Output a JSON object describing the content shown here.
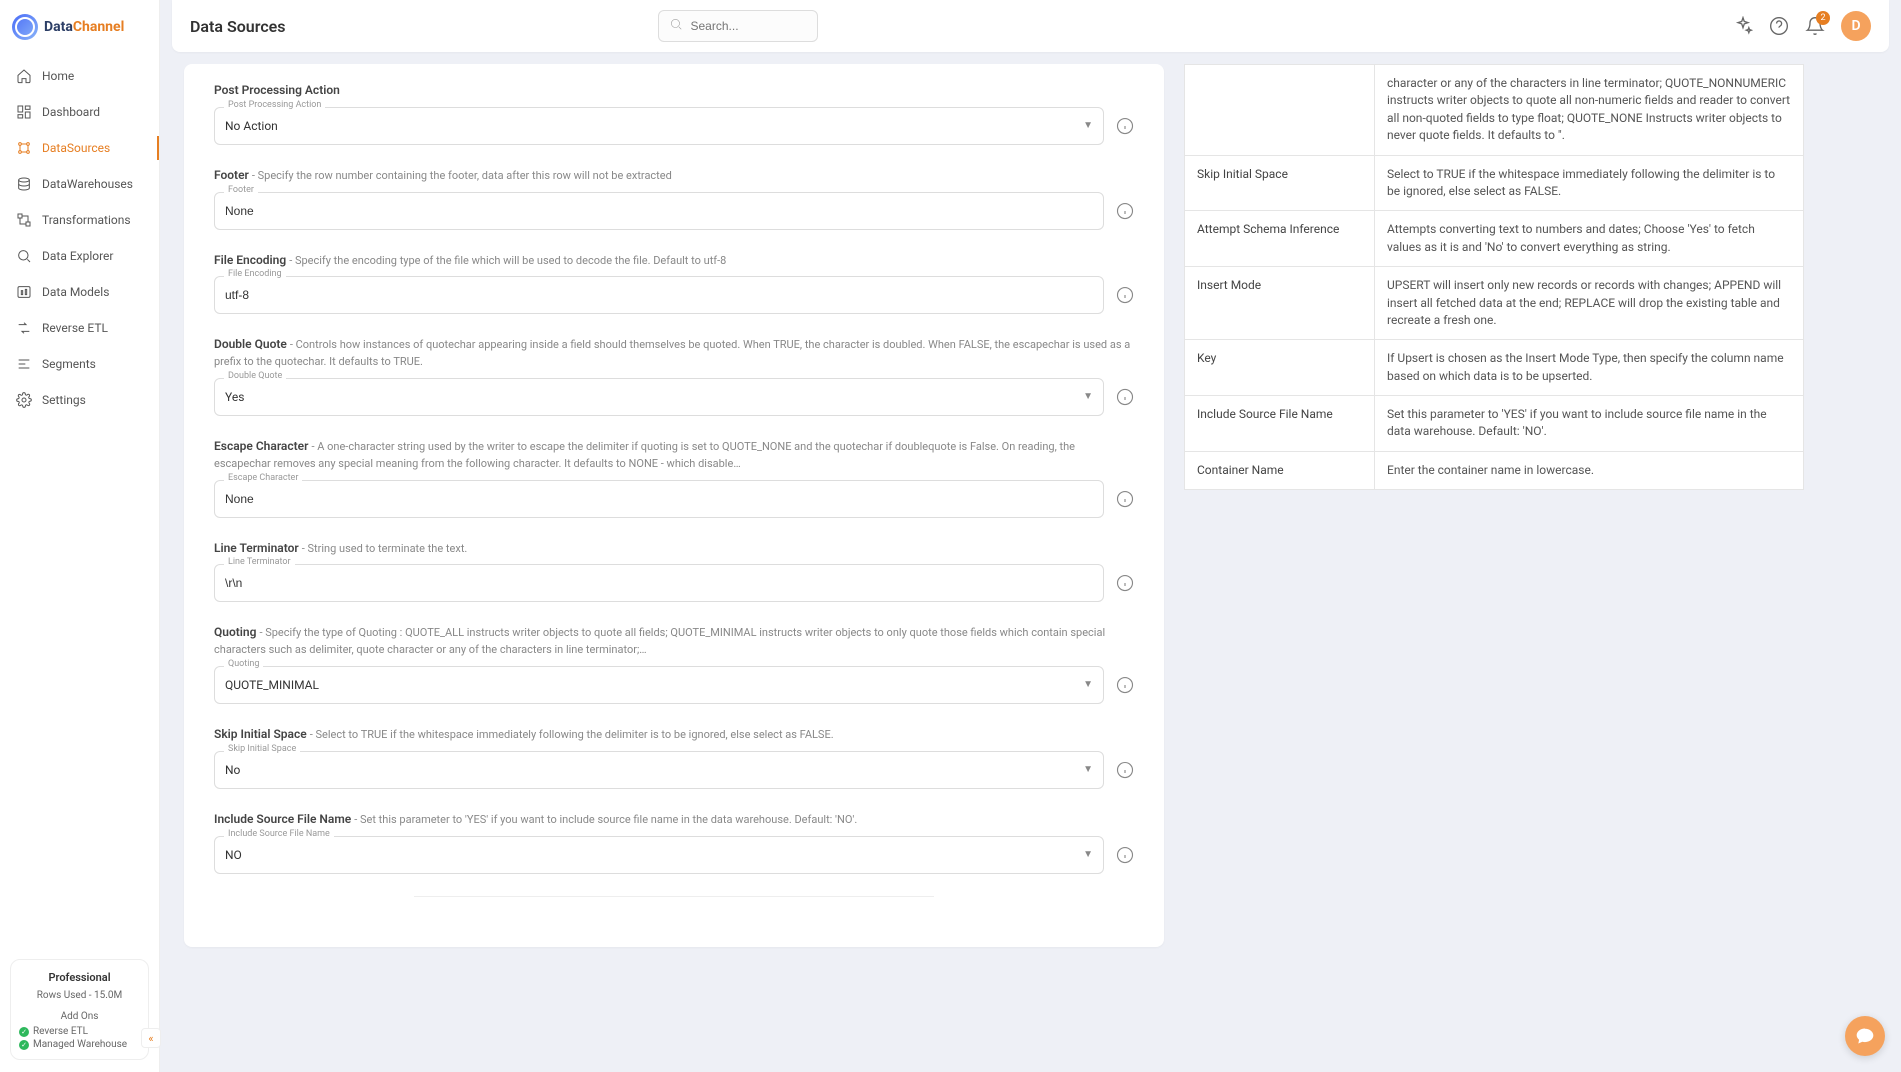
{
  "brand": {
    "part1": "Data",
    "part2": "Channel"
  },
  "nav": [
    {
      "label": "Home"
    },
    {
      "label": "Dashboard"
    },
    {
      "label": "DataSources"
    },
    {
      "label": "DataWarehouses"
    },
    {
      "label": "Transformations"
    },
    {
      "label": "Data Explorer"
    },
    {
      "label": "Data Models"
    },
    {
      "label": "Reverse ETL"
    },
    {
      "label": "Segments"
    },
    {
      "label": "Settings"
    }
  ],
  "plan": {
    "title": "Professional",
    "rows": "Rows Used - 15.0M",
    "addons": "Add Ons",
    "feat1": "Reverse ETL",
    "feat2": "Managed Warehouse"
  },
  "header": {
    "title": "Data Sources",
    "search_placeholder": "Search...",
    "notif_count": "2",
    "avatar": "D"
  },
  "form": {
    "postproc": {
      "name": "Post Processing Action",
      "float": "Post Processing Action",
      "value": "No Action"
    },
    "footer": {
      "name": "Footer",
      "desc": "- Specify the row number containing the footer, data after this row will not be extracted",
      "float": "Footer",
      "value": "None"
    },
    "encoding": {
      "name": "File Encoding",
      "desc": "- Specify the encoding type of the file which will be used to decode the file. Default to utf-8",
      "float": "File Encoding",
      "value": "utf-8"
    },
    "dquote": {
      "name": "Double Quote",
      "desc": "- Controls how instances of quotechar appearing inside a field should themselves be quoted. When TRUE, the character is doubled. When FALSE, the escapechar is used as a prefix to the quotechar. It defaults to TRUE.",
      "float": "Double Quote",
      "value": "Yes"
    },
    "escape": {
      "name": "Escape Character",
      "desc": "- A one-character string used by the writer to escape the delimiter if quoting is set to QUOTE_NONE and the quotechar if doublequote is False. On reading, the escapechar removes any special meaning from the following character. It defaults to NONE - which disable…",
      "float": "Escape Character",
      "value": "None"
    },
    "lterm": {
      "name": "Line Terminator",
      "desc": "- String used to terminate the text.",
      "float": "Line Terminator",
      "value": "\\r\\n"
    },
    "quoting": {
      "name": "Quoting",
      "desc": "- Specify the type of Quoting : QUOTE_ALL instructs writer objects to quote all fields; QUOTE_MINIMAL instructs writer objects to only quote those fields which contain special characters such as delimiter, quote character or any of the characters in line terminator;…",
      "float": "Quoting",
      "value": "QUOTE_MINIMAL"
    },
    "skip": {
      "name": "Skip Initial Space",
      "desc": "- Select to TRUE if the whitespace immediately following the delimiter is to be ignored, else select as FALSE.",
      "float": "Skip Initial Space",
      "value": "No"
    },
    "incsrc": {
      "name": "Include Source File Name",
      "desc": "- Set this parameter to 'YES' if you want to include source file name in the data warehouse. Default: 'NO'.",
      "float": "Include Source File Name",
      "value": "NO"
    }
  },
  "help": [
    {
      "k": "",
      "v": "character or any of the characters in line terminator; QUOTE_NONNUMERIC instructs writer objects to quote all non-numeric fields and reader to convert all non-quoted fields to type float; QUOTE_NONE Instructs writer objects to never quote fields. It defaults to \"."
    },
    {
      "k": "Skip Initial Space",
      "v": "Select to TRUE if the whitespace immediately following the delimiter is to be ignored, else select as FALSE."
    },
    {
      "k": "Attempt Schema Inference",
      "v": "Attempts converting text to numbers and dates; Choose 'Yes' to fetch values as it is and 'No' to convert everything as string."
    },
    {
      "k": "Insert Mode",
      "v": "UPSERT will insert only new records or records with changes; APPEND will insert all fetched data at the end; REPLACE will drop the existing table and recreate a fresh one."
    },
    {
      "k": "Key",
      "v": "If Upsert is chosen as the Insert Mode Type, then specify the column name based on which data is to be upserted."
    },
    {
      "k": "Include Source File Name",
      "v": "Set this parameter to 'YES' if you want to include source file name in the data warehouse. Default: 'NO'."
    },
    {
      "k": "Container Name",
      "v": "Enter the container name in lowercase."
    }
  ]
}
